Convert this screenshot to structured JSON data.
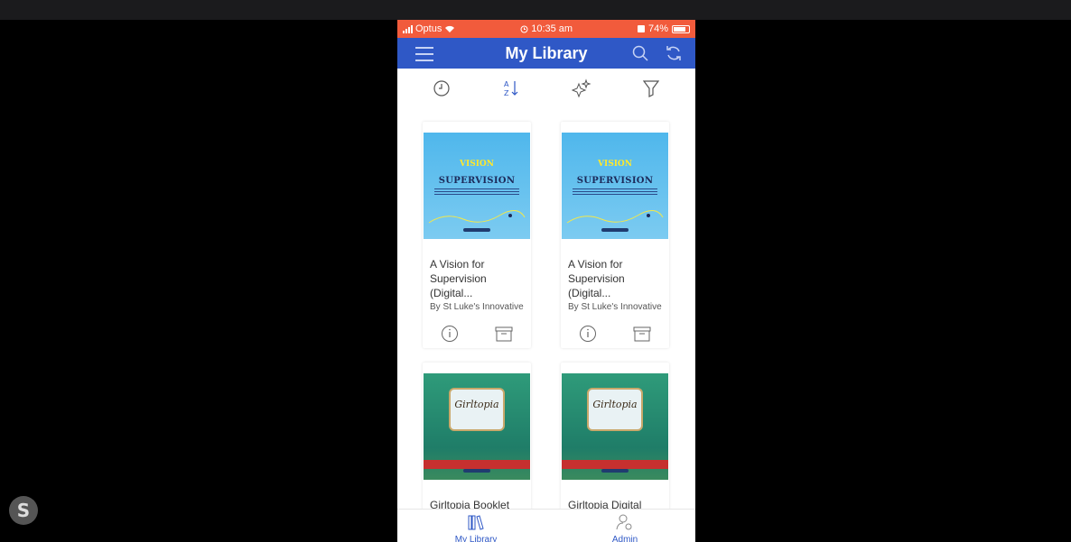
{
  "status_bar": {
    "carrier": "Optus",
    "time": "10:35 am",
    "battery": "74%"
  },
  "nav": {
    "title": "My Library"
  },
  "toolbar": {
    "tools": [
      {
        "name": "recent-sort",
        "icon": "clock-icon"
      },
      {
        "name": "alpha-sort",
        "icon": "az-sort-icon"
      },
      {
        "name": "new-items",
        "icon": "sparkle-icon"
      },
      {
        "name": "filter",
        "icon": "filter-icon"
      }
    ]
  },
  "books": [
    {
      "cover_line1": "VISION",
      "cover_line2": "SUPERVISION",
      "title_line1": "A Vision for",
      "title_line2": "Supervision (Digital...",
      "author": "By St Luke's Innovative..."
    },
    {
      "cover_line1": "VISION",
      "cover_line2": "SUPERVISION",
      "title_line1": "A Vision for",
      "title_line2": "Supervision (Digital...",
      "author": "By St Luke's Innovative..."
    },
    {
      "cover_text": "Girltopia",
      "title_line1": "Girltopia Booklet",
      "title_line2": "",
      "author": ""
    },
    {
      "cover_text": "Girltopia",
      "title_line1": "Girltopia Digital",
      "title_line2": "",
      "author": ""
    }
  ],
  "tabs": [
    {
      "label": "My Library",
      "icon": "books-icon"
    },
    {
      "label": "Admin",
      "icon": "user-gear-icon"
    }
  ],
  "colors": {
    "status": "#f15b3c",
    "nav": "#2f58c6",
    "accent": "#2f58c6"
  }
}
